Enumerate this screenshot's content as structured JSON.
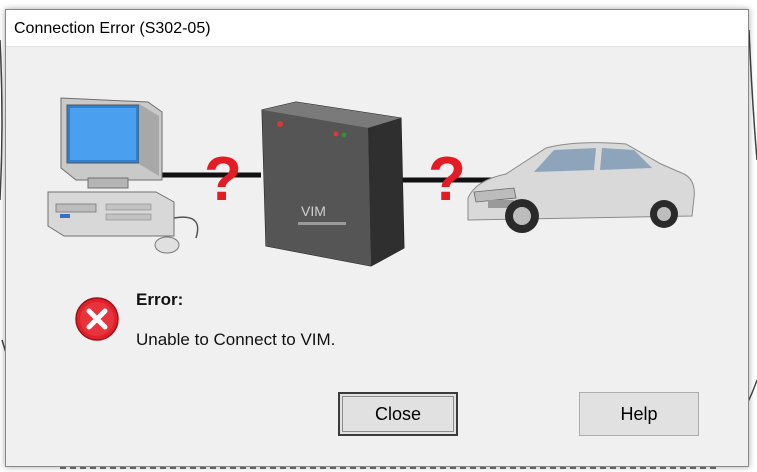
{
  "dialog": {
    "title": "Connection Error (S302-05)",
    "error_heading": "Error:",
    "error_message": "Unable to Connect to VIM.",
    "icon": "error-x-icon"
  },
  "illustration": {
    "computer_icon": "desktop-computer-icon",
    "vim_icon": "vim-device-icon",
    "vim_label": "VIM",
    "car_icon": "car-icon",
    "unknown_marker_1": "?",
    "unknown_marker_2": "?"
  },
  "buttons": {
    "close_label": "Close",
    "help_label": "Help"
  },
  "colors": {
    "error_red": "#e0202a",
    "question_red": "#e51c23",
    "dialog_bg": "#f0f0f0"
  }
}
